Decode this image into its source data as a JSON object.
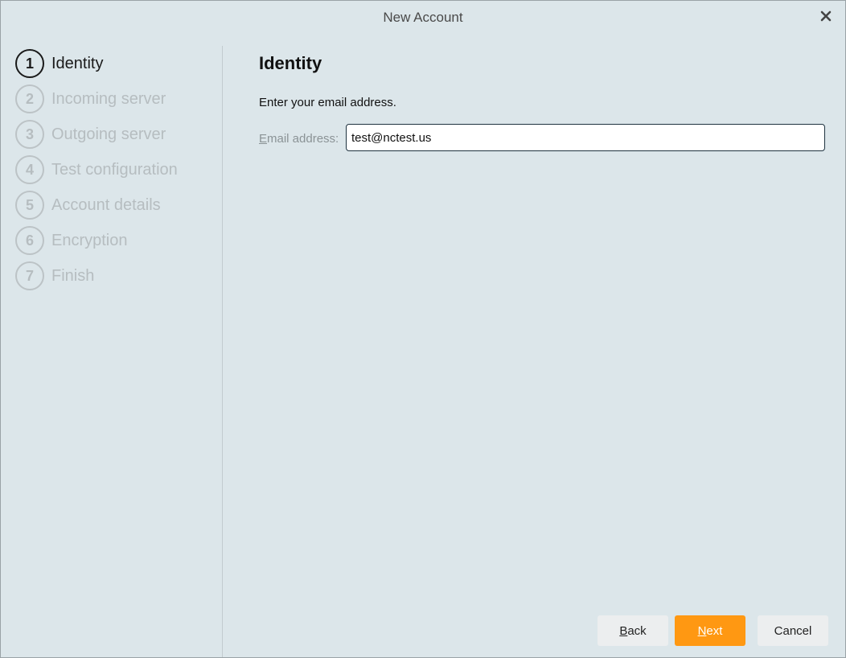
{
  "window": {
    "title": "New Account"
  },
  "sidebar": {
    "steps": [
      {
        "number": "1",
        "label": "Identity",
        "active": true
      },
      {
        "number": "2",
        "label": "Incoming server",
        "active": false
      },
      {
        "number": "3",
        "label": "Outgoing server",
        "active": false
      },
      {
        "number": "4",
        "label": "Test configuration",
        "active": false
      },
      {
        "number": "5",
        "label": "Account details",
        "active": false
      },
      {
        "number": "6",
        "label": "Encryption",
        "active": false
      },
      {
        "number": "7",
        "label": "Finish",
        "active": false
      }
    ]
  },
  "content": {
    "title": "Identity",
    "description": "Enter your email address.",
    "email_label_first": "E",
    "email_label_rest": "mail address:",
    "email_value": "test@nctest.us"
  },
  "buttons": {
    "back_first": "B",
    "back_rest": "ack",
    "next_first": "N",
    "next_rest": "ext",
    "cancel": "Cancel"
  },
  "colors": {
    "background": "#dce6ea",
    "accent": "#ff9812",
    "inactive_step": "#b6bdc0"
  },
  "icons": {
    "close": "close-icon"
  }
}
